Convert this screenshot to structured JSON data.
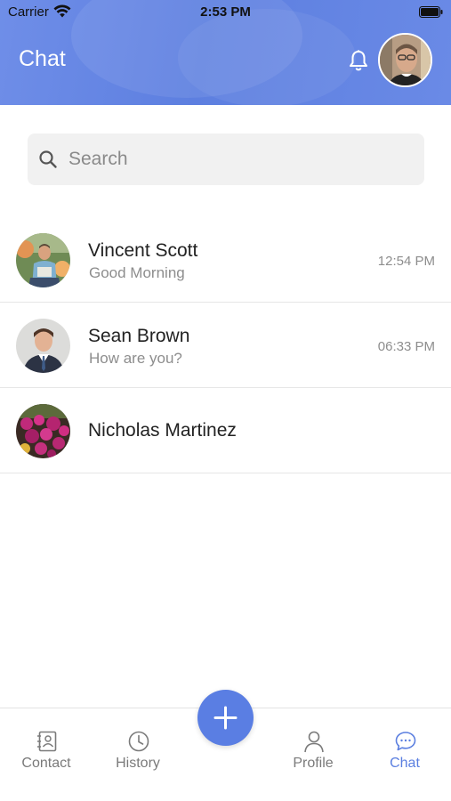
{
  "status_bar": {
    "carrier": "Carrier",
    "time": "2:53 PM"
  },
  "header": {
    "title": "Chat",
    "bell_icon": "bell-icon",
    "avatar_icon": "user-avatar"
  },
  "search": {
    "placeholder": "Search",
    "value": ""
  },
  "chats": [
    {
      "name": "Vincent Scott",
      "message": "Good Morning",
      "time": "12:54 PM"
    },
    {
      "name": "Sean Brown",
      "message": "How are you?",
      "time": "06:33 PM"
    },
    {
      "name": "Nicholas Martinez",
      "message": "",
      "time": ""
    }
  ],
  "fab": {
    "icon": "plus-icon"
  },
  "tabs": [
    {
      "label": "Contact",
      "icon": "contact-book-icon",
      "active": false
    },
    {
      "label": "History",
      "icon": "clock-icon",
      "active": false
    },
    {
      "label": "Profile",
      "icon": "person-icon",
      "active": false
    },
    {
      "label": "Chat",
      "icon": "chat-bubble-icon",
      "active": true
    }
  ],
  "colors": {
    "accent": "#5a7ee3",
    "header": "#6a8ae6",
    "muted_text": "#8d8d8d"
  }
}
